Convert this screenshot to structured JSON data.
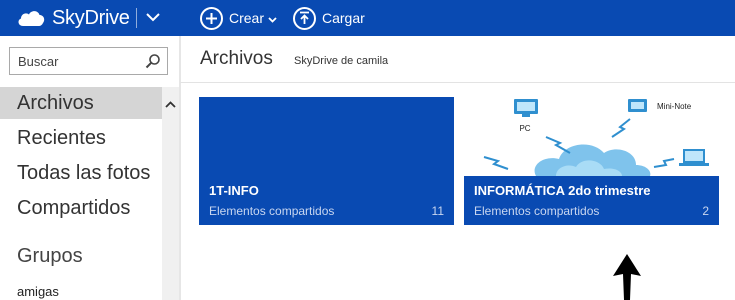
{
  "app": {
    "brand": "SkyDrive",
    "brand_color": "#094ab2"
  },
  "toolbar": {
    "create_label": "Crear",
    "upload_label": "Cargar",
    "icons": [
      "plus-circle-icon",
      "upload-circle-icon",
      "chevron-down-icon",
      "cloud-icon"
    ]
  },
  "search": {
    "placeholder": "Buscar"
  },
  "sidebar": {
    "items": [
      {
        "label": "Archivos",
        "active": true
      },
      {
        "label": "Recientes",
        "active": false
      },
      {
        "label": "Todas las fotos",
        "active": false
      },
      {
        "label": "Compartidos",
        "active": false
      }
    ],
    "groups_heading": "Grupos",
    "groups": [
      {
        "label": "amigas"
      }
    ]
  },
  "main": {
    "title": "Archivos",
    "subtitle": "SkyDrive de camila",
    "tiles": [
      {
        "name": "1T-INFO",
        "subtitle": "Elementos compartidos",
        "count": "11"
      },
      {
        "name": "INFORMÁTICA 2do trimestre",
        "subtitle": "Elementos compartidos",
        "count": "2",
        "art_labels": [
          "PC",
          "Mini-Note"
        ]
      }
    ]
  }
}
